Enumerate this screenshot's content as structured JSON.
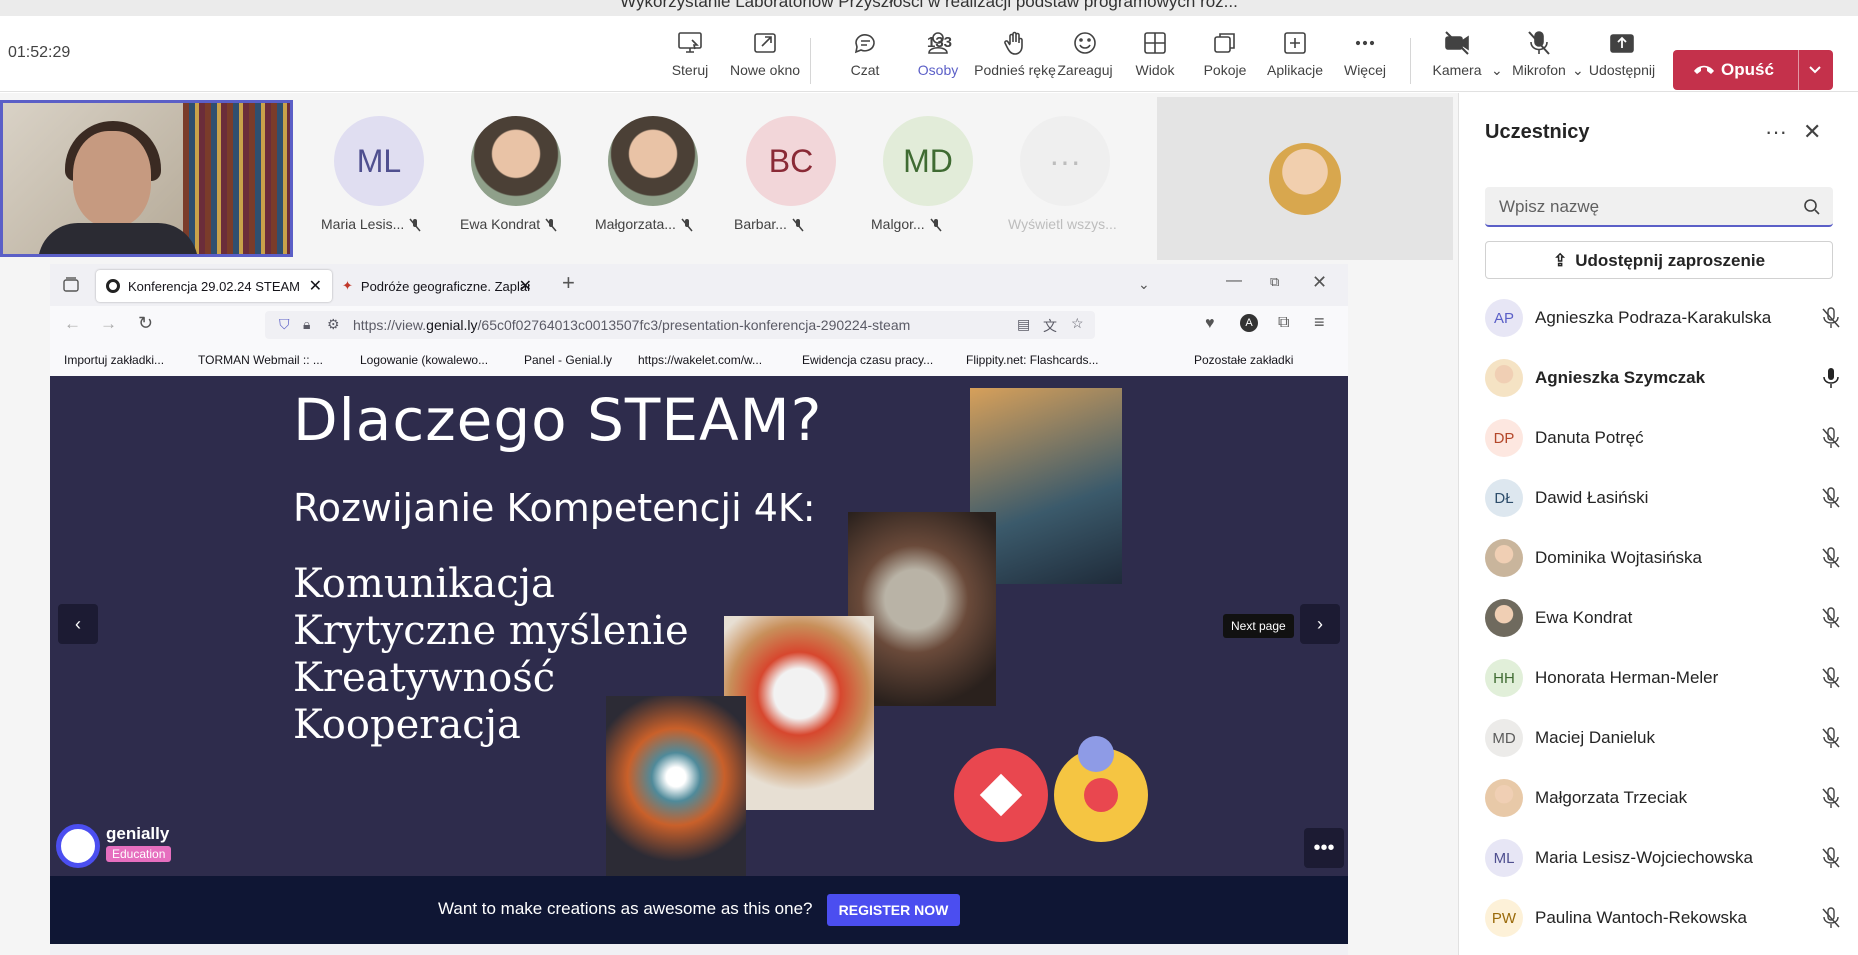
{
  "window_title": "Wykorzystanie Laboratoriów Przyszłości w realizacji podstaw programowych roz...",
  "timer": "01:52:29",
  "toolbar": {
    "items": [
      {
        "label": "Steruj",
        "icon": "screen-control-icon"
      },
      {
        "label": "Nowe okno",
        "icon": "popout-icon"
      },
      {
        "label": "Czat",
        "icon": "chat-icon"
      },
      {
        "label": "Osoby",
        "icon": "people-icon",
        "count": "133",
        "active": true
      },
      {
        "label": "Podnieś rękę",
        "icon": "hand-icon"
      },
      {
        "label": "Zareaguj",
        "icon": "emoji-icon"
      },
      {
        "label": "Widok",
        "icon": "grid-icon"
      },
      {
        "label": "Pokoje",
        "icon": "rooms-icon"
      },
      {
        "label": "Aplikacje",
        "icon": "add-icon"
      },
      {
        "label": "Więcej",
        "icon": "more-icon"
      },
      {
        "label": "Kamera",
        "icon": "camera-off-icon"
      },
      {
        "label": "Mikrofon",
        "icon": "mic-off-icon"
      },
      {
        "label": "Udostępnij",
        "icon": "share-icon"
      }
    ],
    "leave_label": "Opuść",
    "accent": "#5b5fc7",
    "leave_color": "#c4314b"
  },
  "gallery": [
    {
      "initials": "ML",
      "name": "Maria Lesis...",
      "bg": "#e0def1",
      "fg": "#4f4f8f"
    },
    {
      "initials": "",
      "name": "Ewa Kondrat",
      "photo": true
    },
    {
      "initials": "",
      "name": "Małgorzata...",
      "photo": true
    },
    {
      "initials": "BC",
      "name": "Barbar...",
      "bg": "#f2d6d9",
      "fg": "#8a2a36"
    },
    {
      "initials": "MD",
      "name": "Malgor...",
      "bg": "#e2ecd9",
      "fg": "#3f6b32"
    },
    {
      "initials": "···",
      "name": "Wyświetl wszys...",
      "bg": "#efefef",
      "fg": "#bdbdbd"
    }
  ],
  "browser": {
    "tabs": [
      {
        "title": "Konferencja 29.02.24 STEAM",
        "active": true
      },
      {
        "title": "Podróże geograficzne. Zaplanuj",
        "active": false
      }
    ],
    "url_prefix": "https://view.",
    "url_domain": "genial.ly",
    "url_rest": "/65c0f02764013c0013507fc3/presentation-konferencja-290224-steam",
    "bookmarks": [
      "Importuj zakładki...",
      "TORMAN Webmail :: ...",
      "Logowanie (kowalewo...",
      "Panel - Genial.ly",
      "https://wakelet.com/w...",
      "Ewidencja czasu pracy...",
      "Flippity.net: Flashcards...",
      "Pozostałe zakładki"
    ]
  },
  "slide": {
    "title": "Dlaczego STEAM?",
    "subtitle": "Rozwijanie Kompetencji 4K:",
    "items": [
      "Komunikacja",
      "Krytyczne myślenie",
      "Kreatywność",
      "Kooperacja"
    ],
    "tooltip": "Next page",
    "brand": "genially",
    "brand_badge": "Education",
    "cta_text": "Want to make creations as awesome as this one?",
    "cta_button": "REGISTER NOW"
  },
  "panel": {
    "title": "Uczestnicy",
    "search_placeholder": "Wpisz nazwę",
    "invite_label": "Udostępnij zaproszenie",
    "participants": [
      {
        "initials": "AP",
        "name": "Agnieszka Podraza-Karakulska",
        "bg": "#e7e6f5",
        "fg": "#5b5fc7",
        "mic": "off"
      },
      {
        "initials": "",
        "name": "Agnieszka Szymczak",
        "bg": "#f5e3c4",
        "fg": "#6b4a1a",
        "mic": "on",
        "photo": true,
        "bold": true
      },
      {
        "initials": "DP",
        "name": "Danuta Potręć",
        "bg": "#fde7e0",
        "fg": "#b4472a",
        "mic": "off"
      },
      {
        "initials": "DŁ",
        "name": "Dawid Łasiński",
        "bg": "#dde7ef",
        "fg": "#2d4d6b",
        "mic": "off"
      },
      {
        "initials": "",
        "name": "Dominika Wojtasińska",
        "bg": "#c9b59c",
        "fg": "#fff",
        "mic": "off",
        "photo": true
      },
      {
        "initials": "",
        "name": "Ewa Kondrat",
        "bg": "#6f6a5e",
        "fg": "#fff",
        "mic": "off",
        "photo": true
      },
      {
        "initials": "HH",
        "name": "Honorata Herman-Meler",
        "bg": "#e1efd9",
        "fg": "#3f6b32",
        "mic": "off"
      },
      {
        "initials": "MD",
        "name": "Maciej Danieluk",
        "bg": "#ecebe9",
        "fg": "#5b5b5b",
        "mic": "off"
      },
      {
        "initials": "",
        "name": "Małgorzata Trzeciak",
        "bg": "#e8c9a8",
        "fg": "#fff",
        "mic": "off",
        "photo": true
      },
      {
        "initials": "ML",
        "name": "Maria Lesisz-Wojciechowska",
        "bg": "#e7e6f5",
        "fg": "#4f4f8f",
        "mic": "off"
      },
      {
        "initials": "PW",
        "name": "Paulina Wantoch-Rekowska",
        "bg": "#fdf1d8",
        "fg": "#9a6a0a",
        "mic": "off"
      }
    ]
  }
}
